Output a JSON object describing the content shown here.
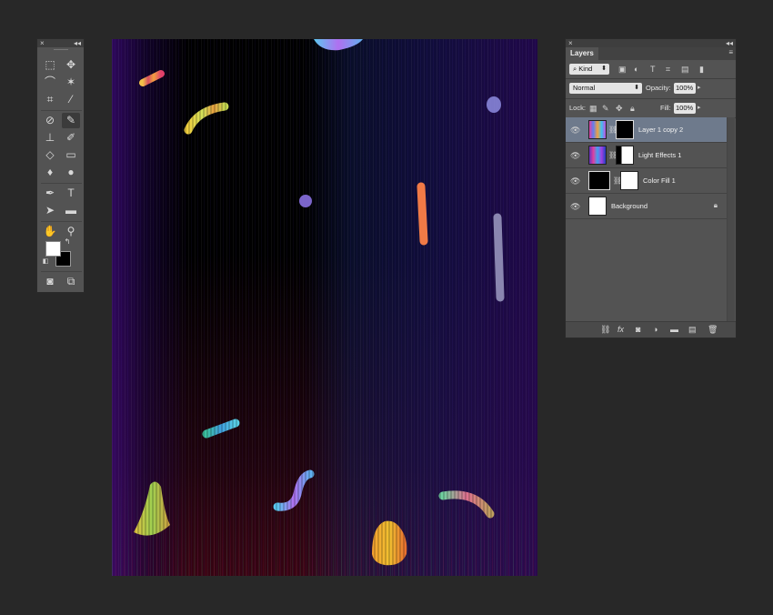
{
  "tools_panel": {
    "close_icon": "×",
    "collapse_icon": "◂◂"
  },
  "layers_panel": {
    "close_icon": "×",
    "collapse_icon": "◂◂",
    "tab_label": "Layers",
    "menu_icon": "≡",
    "filter": {
      "search_symbol": "⌕",
      "value": "Kind"
    },
    "blend_mode": "Normal",
    "opacity_label": "Opacity:",
    "opacity_value": "100%",
    "lock_label": "Lock:",
    "fill_label": "Fill:",
    "fill_value": "100%",
    "layers": [
      {
        "name": "Layer 1 copy 2",
        "selected": true,
        "visible": true
      },
      {
        "name": "Light Effects 1",
        "selected": false,
        "visible": true
      },
      {
        "name": "Color Fill 1",
        "selected": false,
        "visible": true
      },
      {
        "name": "Background",
        "selected": false,
        "visible": true,
        "locked": true
      }
    ],
    "bottom_icons": [
      "link-icon",
      "fx-icon",
      "mask-icon",
      "adjustment-icon",
      "group-folder-icon",
      "new-layer-icon",
      "trash-icon"
    ]
  },
  "colors": {
    "panel_bg": "#535353",
    "app_bg": "#282828",
    "selected_layer": "#6e7a8c",
    "foreground_color": "#ffffff",
    "background_color": "#000000"
  }
}
